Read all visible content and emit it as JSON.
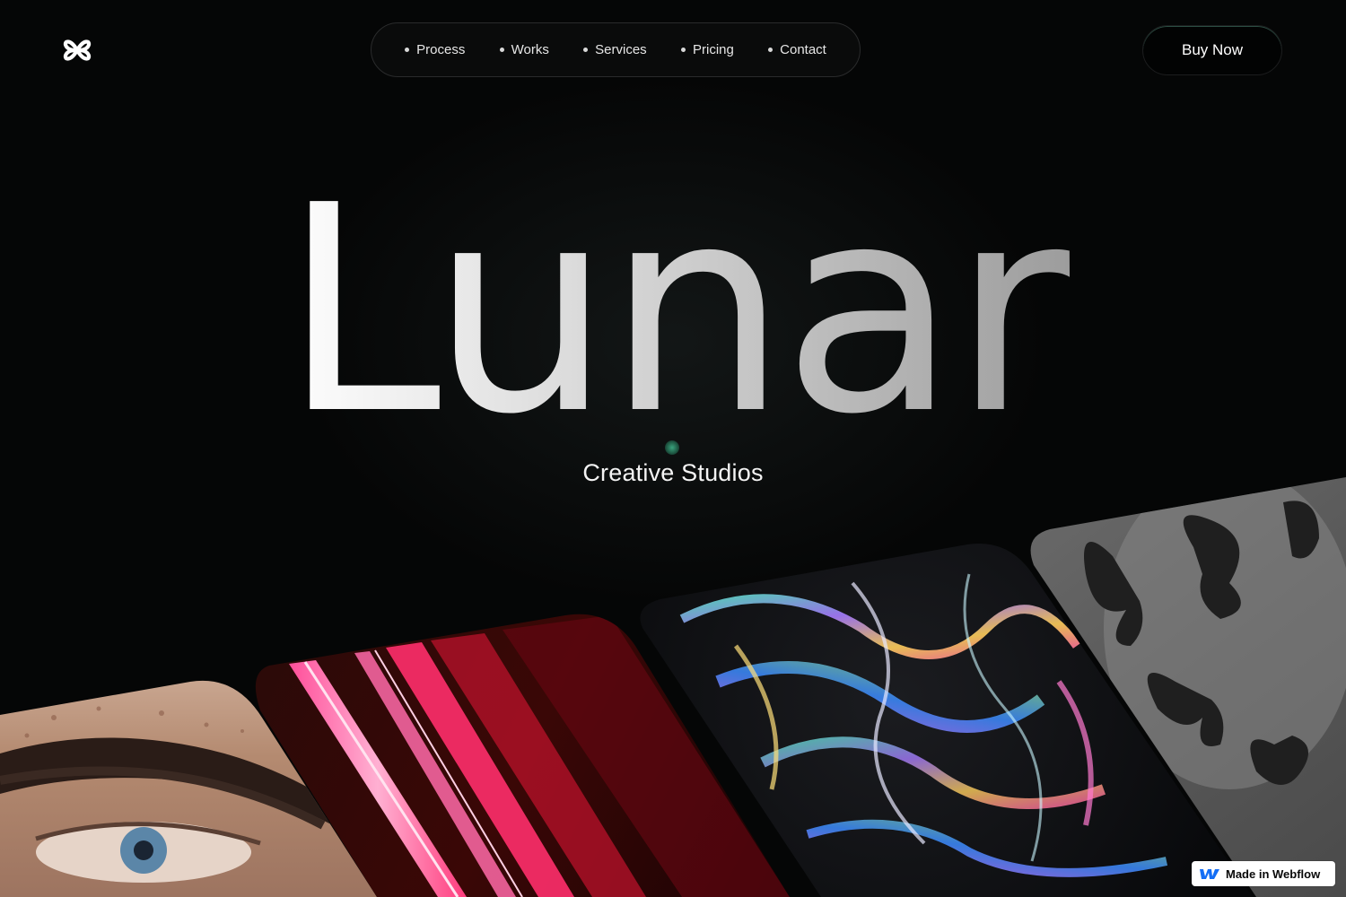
{
  "header": {
    "logo_icon": "flower-knot-logo-icon",
    "nav": [
      {
        "label": "Process"
      },
      {
        "label": "Works"
      },
      {
        "label": "Services"
      },
      {
        "label": "Pricing"
      },
      {
        "label": "Contact"
      }
    ],
    "buy_label": "Buy Now"
  },
  "hero": {
    "title": "Lunar",
    "subtitle": "Creative Studios",
    "accent_color": "#3aa37d"
  },
  "gallery": {
    "cards": [
      {
        "name": "eye-closeup-image"
      },
      {
        "name": "pink-neon-light-image"
      },
      {
        "name": "iridescent-fabric-image"
      },
      {
        "name": "butterfly-silhouette-image"
      }
    ]
  },
  "badge": {
    "icon": "webflow-logo-icon",
    "label": "Made in Webflow"
  }
}
